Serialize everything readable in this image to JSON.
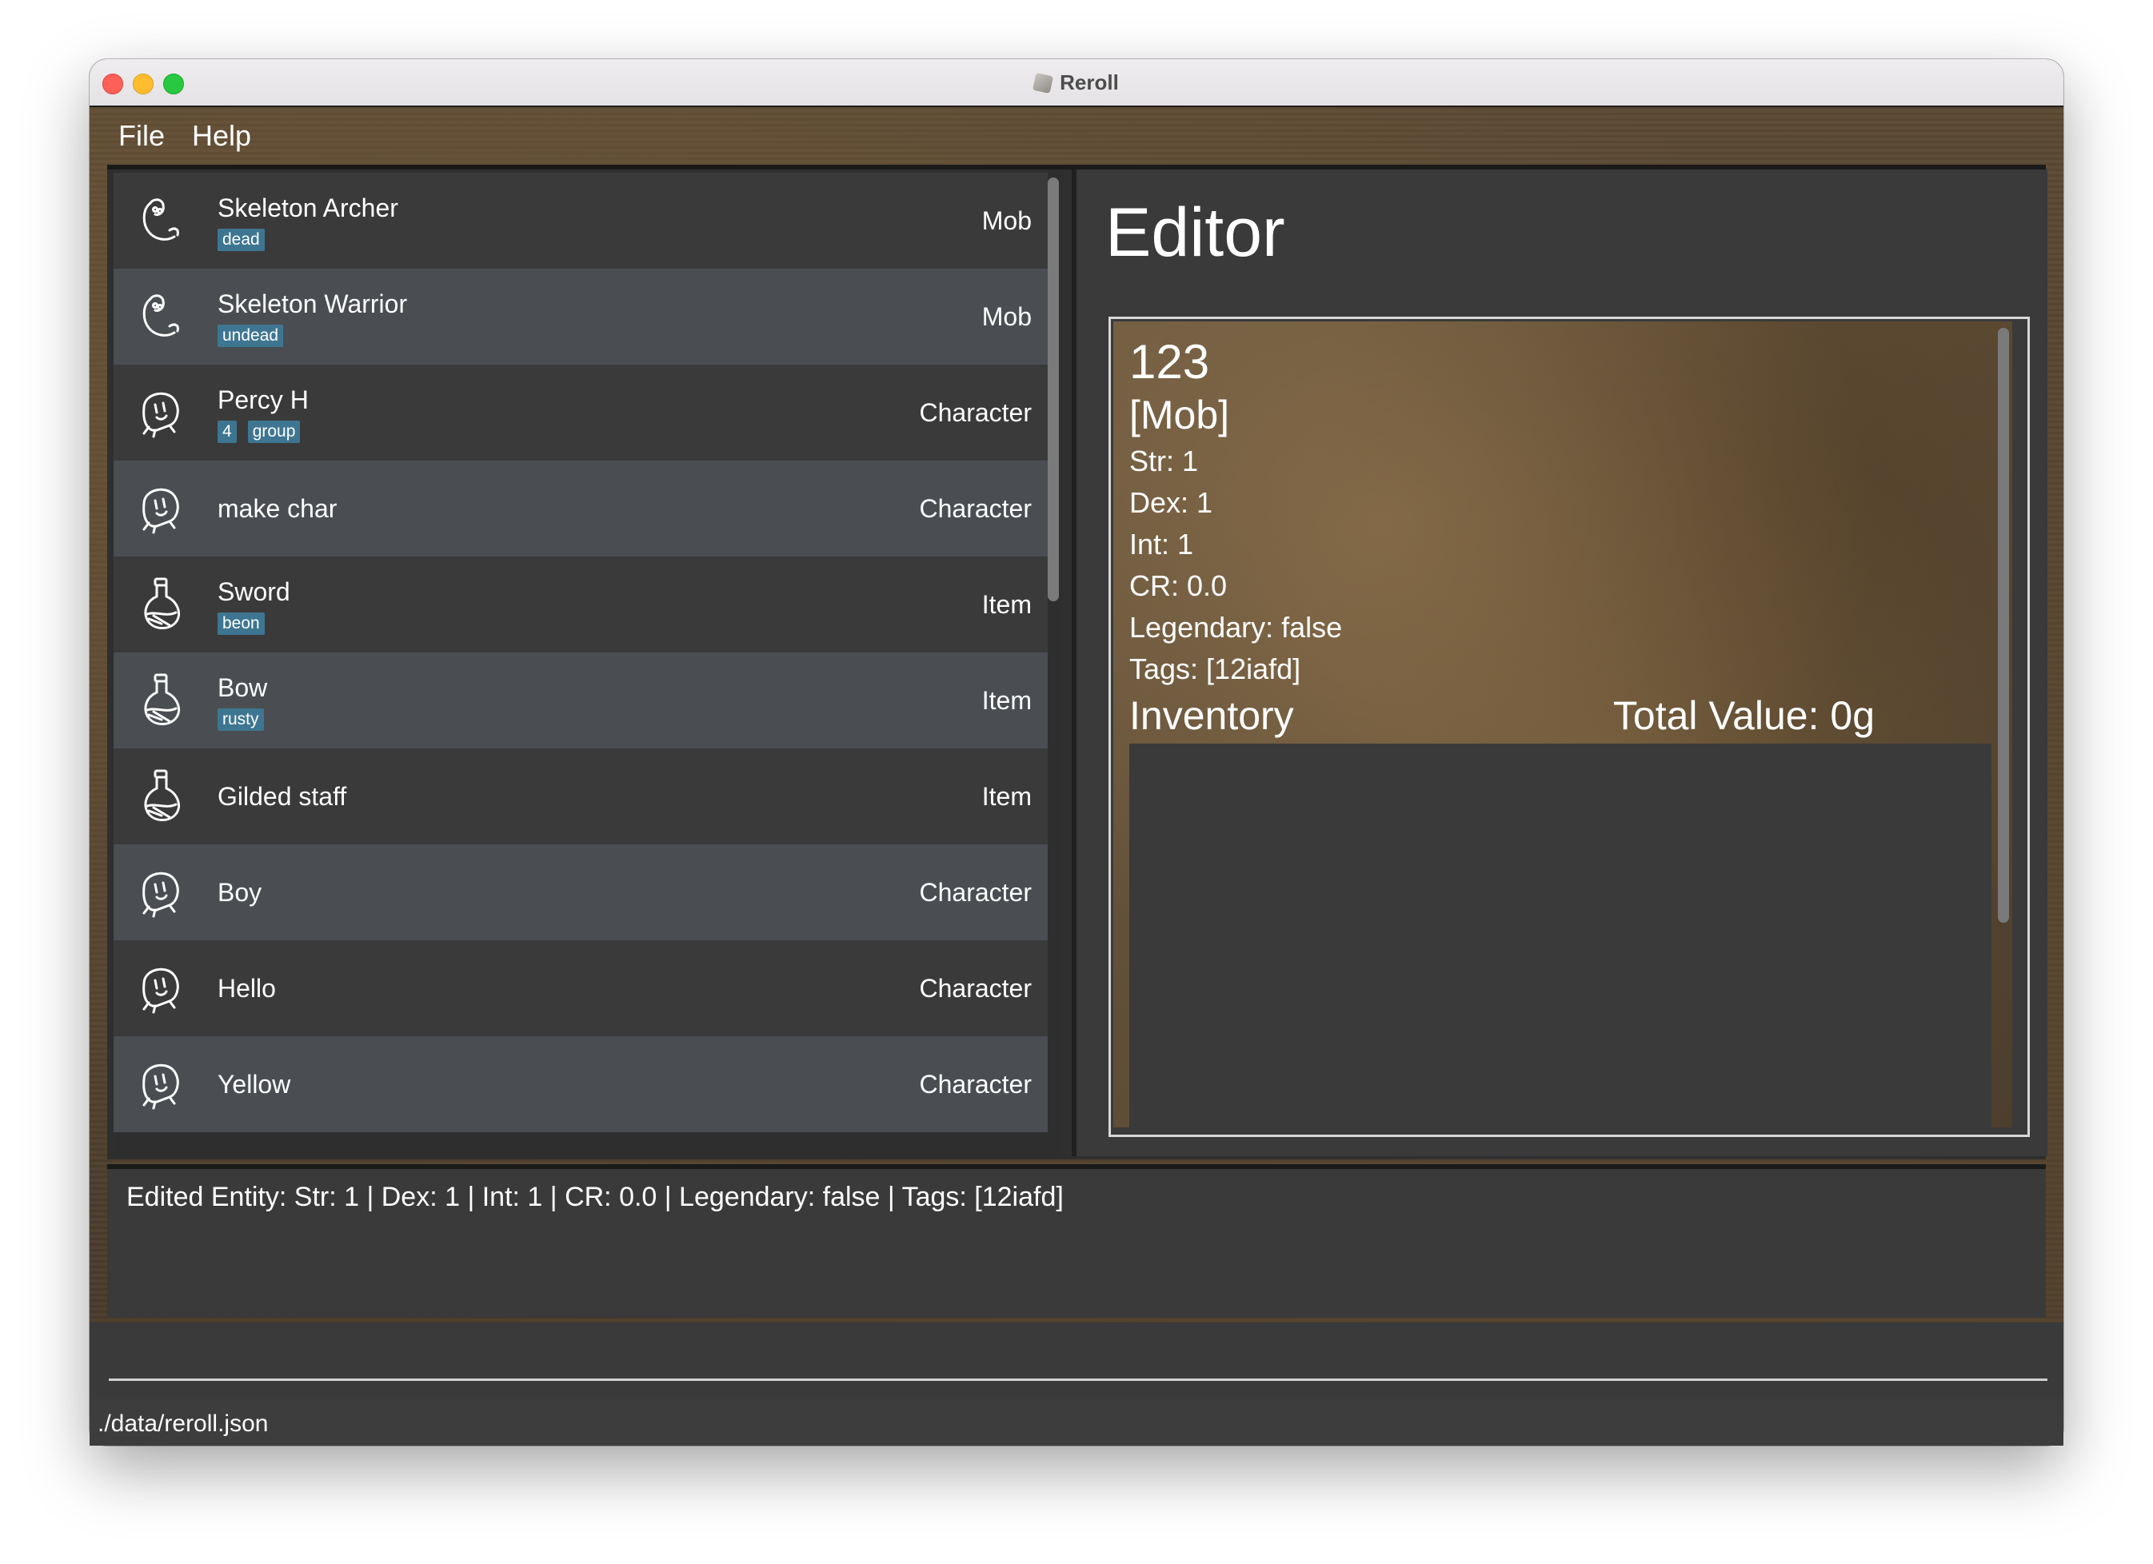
{
  "window": {
    "title": "Reroll"
  },
  "menu": [
    "File",
    "Help"
  ],
  "entities": [
    {
      "name": "Skeleton Archer",
      "tags": [
        "dead"
      ],
      "type": "Mob",
      "icon": "skeleton-icon"
    },
    {
      "name": "Skeleton Warrior",
      "tags": [
        "undead"
      ],
      "type": "Mob",
      "icon": "skeleton-icon"
    },
    {
      "name": "Percy H",
      "tags": [
        "4",
        "group"
      ],
      "type": "Character",
      "icon": "character-icon"
    },
    {
      "name": "make char",
      "tags": [],
      "type": "Character",
      "icon": "character-icon"
    },
    {
      "name": "Sword",
      "tags": [
        "beon"
      ],
      "type": "Item",
      "icon": "potion-icon"
    },
    {
      "name": "Bow",
      "tags": [
        "rusty"
      ],
      "type": "Item",
      "icon": "potion-icon"
    },
    {
      "name": "Gilded staff",
      "tags": [],
      "type": "Item",
      "icon": "potion-icon"
    },
    {
      "name": "Boy",
      "tags": [],
      "type": "Character",
      "icon": "character-icon"
    },
    {
      "name": "Hello",
      "tags": [],
      "type": "Character",
      "icon": "character-icon"
    },
    {
      "name": "Yellow",
      "tags": [],
      "type": "Character",
      "icon": "character-icon"
    }
  ],
  "editor": {
    "heading": "Editor",
    "id": "123",
    "type": "[Mob]",
    "stats": [
      "Str: 1",
      "Dex: 1",
      "Int: 1",
      "CR: 0.0",
      "Legendary: false",
      "Tags: [12iafd]"
    ],
    "inventory_label": "Inventory",
    "total_value": "Total Value: 0g"
  },
  "result": {
    "text": "Edited Entity: Str: 1 | Dex: 1 | Int: 1 | CR: 0.0 | Legendary: false | Tags: [12iafd]"
  },
  "command": {
    "value": ""
  },
  "status": {
    "path": "./data/reroll.json"
  },
  "colors": {
    "tag_bg": "#3e7692",
    "row_dark": "#3a3a3a",
    "row_light": "#4a4e52",
    "panel_bg": "#3a3a3a"
  }
}
